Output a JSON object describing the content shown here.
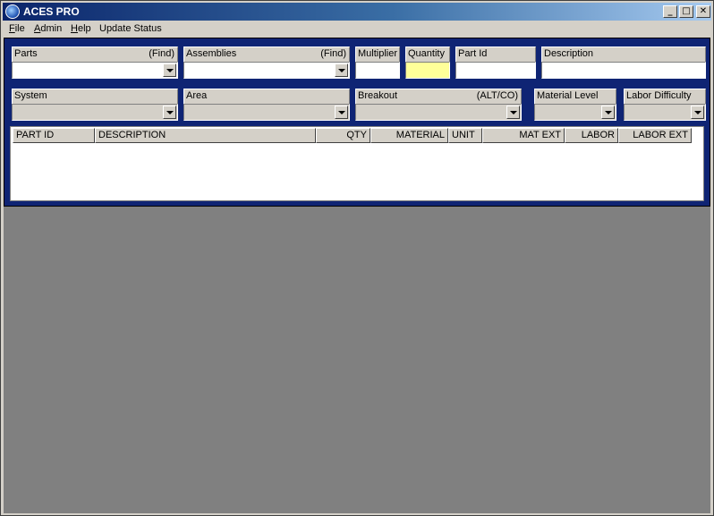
{
  "window": {
    "title": "ACES PRO",
    "minimize_glyph": "_",
    "maximize_glyph": "□",
    "close_glyph": "✕"
  },
  "menu": [
    {
      "label": "File",
      "mnemonic": "F",
      "rest": "ile"
    },
    {
      "label": "Admin",
      "mnemonic": "A",
      "rest": "dmin"
    },
    {
      "label": "Help",
      "mnemonic": "H",
      "rest": "elp"
    },
    {
      "label": "Update Status",
      "mnemonic": "",
      "rest": "Update Status"
    }
  ],
  "row1": {
    "parts": {
      "label": "Parts",
      "hint": "(Find)",
      "value": ""
    },
    "assemblies": {
      "label": "Assemblies",
      "hint": "(Find)",
      "value": ""
    },
    "multiplier": {
      "label": "Multiplier",
      "value": ""
    },
    "quantity": {
      "label": "Quantity",
      "value": ""
    },
    "part_id": {
      "label": "Part Id",
      "value": ""
    },
    "description": {
      "label": "Description",
      "value": ""
    }
  },
  "row2": {
    "system": {
      "label": "System",
      "value": ""
    },
    "area": {
      "label": "Area",
      "value": ""
    },
    "breakout": {
      "label": "Breakout",
      "hint": "(ALT/CO)",
      "value": ""
    },
    "material_level": {
      "label": "Material Level",
      "value": ""
    },
    "labor_difficulty": {
      "label": "Labor Difficulty",
      "value": ""
    }
  },
  "grid": {
    "columns": [
      "PART ID",
      "DESCRIPTION",
      "QTY",
      "MATERIAL",
      "UNIT",
      "MAT EXT",
      "LABOR",
      "LABOR EXT"
    ],
    "rows": []
  },
  "colors": {
    "titlebar_start": "#0a246a",
    "panel_background": "#0f2474",
    "quantity_highlight": "#ffff99",
    "workspace": "#808080"
  }
}
